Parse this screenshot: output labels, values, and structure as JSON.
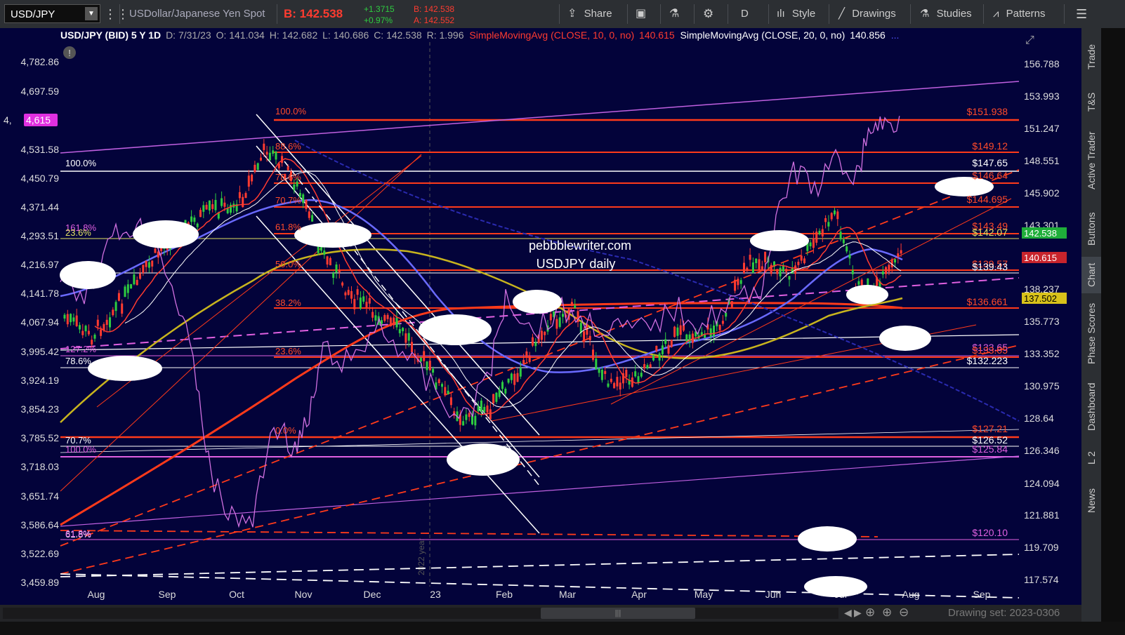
{
  "toolbar": {
    "symbol": "USD/JPY",
    "description": "USDollar/Japanese Yen Spot",
    "bid": "B: 142.538",
    "change": "+1.3715",
    "change_pct": "+0.97%",
    "bid_small": "B: 142.538",
    "ask_small": "A: 142.552",
    "share": "Share",
    "aggregation": "D",
    "style": "Style",
    "drawings": "Drawings",
    "studies": "Studies",
    "patterns": "Patterns"
  },
  "header": {
    "title": "USD/JPY (BID) 5 Y 1D",
    "date": "D: 7/31/23",
    "open": "O: 141.034",
    "high": "H: 142.682",
    "low": "L: 140.686",
    "close": "C: 142.538",
    "range": "R: 1.996",
    "sma10": "SimpleMovingAvg (CLOSE, 10, 0, no)",
    "sma10_val": "140.615",
    "sma20": "SimpleMovingAvg (CLOSE, 20, 0, no)",
    "sma20_val": "140.856",
    "more": "..."
  },
  "watermark": {
    "line1": "pebbblewriter.com",
    "line2": "USDJPY daily"
  },
  "left_axis": [
    "4,782.86",
    "4,697.59",
    "4,615",
    "4,531.58",
    "4,450.79",
    "4,371.44",
    "4,293.51",
    "4,216.97",
    "4,141.78",
    "4,067.94",
    "3,995.42",
    "3,924.19",
    "3,854.23",
    "3,785.52",
    "3,718.03",
    "3,651.74",
    "3,586.64",
    "3,522.69",
    "3,459.89"
  ],
  "left_axis_highlight": "4,615",
  "right_axis": [
    "156.788",
    "153.993",
    "151.247",
    "148.551",
    "145.902",
    "143.301",
    "140.61",
    "138.237",
    "135.773",
    "133.352",
    "130.975",
    "128.64",
    "126.346",
    "124.094",
    "121.881",
    "119.709",
    "117.574"
  ],
  "price_flags": [
    {
      "text": "142.538",
      "color": "#1fae3a"
    },
    {
      "text": "140.615",
      "color": "#c8242c"
    },
    {
      "text": "137.502",
      "color": "#d9c21a"
    }
  ],
  "months": [
    "Aug",
    "Sep",
    "Oct",
    "Nov",
    "Dec",
    "23",
    "Feb",
    "Mar",
    "Apr",
    "May",
    "Jun",
    "Jul",
    "Aug",
    "Sep"
  ],
  "year_marker": "2022 year",
  "fib_left": [
    {
      "text": "100.0%",
      "color": "#ffffff"
    },
    {
      "text": "161.8%",
      "color": "#e060e0"
    },
    {
      "text": "23.6%",
      "color": "#e0e060"
    },
    {
      "text": "127.2%",
      "color": "#e060e0"
    },
    {
      "text": "78.6%",
      "color": "#ffffff"
    },
    {
      "text": "70.7%",
      "color": "#ffffff"
    },
    {
      "text": "100.0%",
      "color": "#e060e0"
    },
    {
      "text": "61.8%",
      "color": "#ffffff"
    },
    {
      "text": "61.8%",
      "color": "#e060e0"
    }
  ],
  "fib_mid": [
    {
      "text": "100.0%"
    },
    {
      "text": "88.6%"
    },
    {
      "text": "78.6%"
    },
    {
      "text": "70.7%"
    },
    {
      "text": "61.8%"
    },
    {
      "text": "50.0%"
    },
    {
      "text": "38.2%"
    },
    {
      "text": "23.6%"
    },
    {
      "text": "0.0%"
    }
  ],
  "level_labels": [
    {
      "text": "$151.938",
      "color": "#ff4a2a"
    },
    {
      "text": "$149.12",
      "color": "#ff4a2a"
    },
    {
      "text": "$147.65",
      "color": "#ffffff"
    },
    {
      "text": "$146.64",
      "color": "#ff4a2a"
    },
    {
      "text": "$144.695",
      "color": "#ff4a2a"
    },
    {
      "text": "$143.49",
      "color": "#ff4a2a"
    },
    {
      "text": "$142.07",
      "color": "#e0e060"
    },
    {
      "text": "$139.57",
      "color": "#ff4a2a"
    },
    {
      "text": "$139.43",
      "color": "#ffffff"
    },
    {
      "text": "$136.661",
      "color": "#ff4a2a"
    },
    {
      "text": "$133.65",
      "color": "#e060e0"
    },
    {
      "text": "$133.05",
      "color": "#ff4a2a"
    },
    {
      "text": "$132.223",
      "color": "#ffffff"
    },
    {
      "text": "$127.21",
      "color": "#ff4a2a"
    },
    {
      "text": "$126.52",
      "color": "#ffffff"
    },
    {
      "text": "$125.84",
      "color": "#e060e0"
    },
    {
      "text": "$120.10",
      "color": "#e060e0"
    }
  ],
  "right_tabs": [
    "Trade",
    "T&S",
    "Active Trader",
    "Buttons",
    "Chart",
    "Phase Scores",
    "Dashboard",
    "L 2",
    "News"
  ],
  "active_tab": "Chart",
  "drawing_set": "Drawing set: 2023-0306",
  "colors": {
    "bg": "#03033a",
    "up": "#2ecc40",
    "down": "#ff3b30",
    "sma10": "#ff3b30",
    "sma20": "#ffffff",
    "ma_blue": "#6a6aff",
    "ma_yellow": "#c8b41e",
    "ma_red": "#ff3a1a",
    "spx": "#d070e0"
  }
}
